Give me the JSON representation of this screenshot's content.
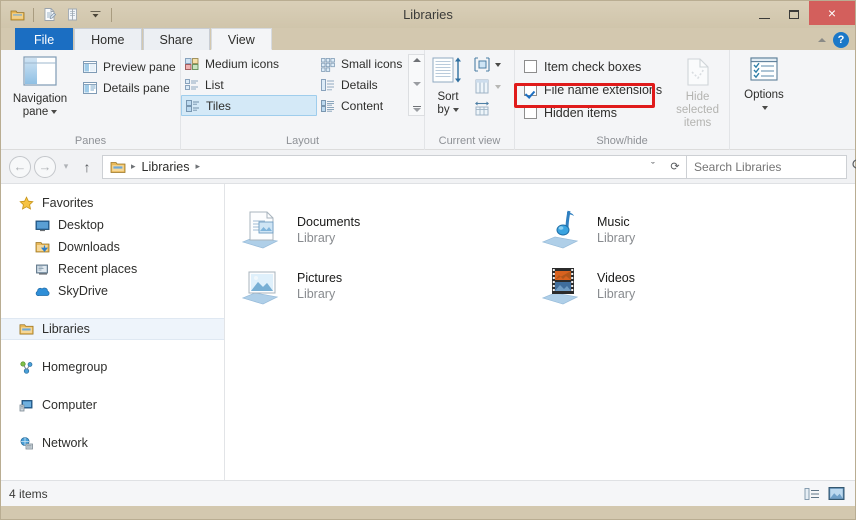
{
  "window": {
    "title": "Libraries",
    "quick_access": [
      "explorer-icon",
      "properties-icon",
      "new-folder-icon",
      "customize-caret"
    ],
    "minimize_label": "Minimize",
    "maximize_label": "Maximize",
    "close_label": "Close",
    "close_glyph": "×",
    "close_color": "#d35f5c",
    "titlebar_color": "#d3c8af"
  },
  "tabs": [
    {
      "label": "File",
      "active": false,
      "accent": "#1b6ec2"
    },
    {
      "label": "Home",
      "active": false
    },
    {
      "label": "Share",
      "active": false
    },
    {
      "label": "View",
      "active": true
    }
  ],
  "tab_right": {
    "collapse_label": "Minimize the Ribbon",
    "help_label": "Help",
    "help_glyph": "?"
  },
  "ribbon": {
    "groups": [
      {
        "label": "Panes",
        "big_button": {
          "label_line1": "Navigation",
          "label_line2": "pane",
          "has_caret": true
        },
        "small_items": [
          {
            "label": "Preview pane",
            "icon": "preview-pane-icon"
          },
          {
            "label": "Details pane",
            "icon": "details-pane-icon"
          }
        ]
      },
      {
        "label": "Layout",
        "items": [
          {
            "label": "Medium icons",
            "selected": false
          },
          {
            "label": "List",
            "selected": false
          },
          {
            "label": "Tiles",
            "selected": true
          },
          {
            "label": "Small icons",
            "selected": false
          },
          {
            "label": "Details",
            "selected": false
          },
          {
            "label": "Content",
            "selected": false
          }
        ],
        "scroll": {
          "up": "scroll-up",
          "down": "scroll-down",
          "more": "more-layouts"
        }
      },
      {
        "label": "Current view",
        "big_button": {
          "label_line1": "Sort",
          "label_line2": "by",
          "has_caret": true
        },
        "small_items": [
          {
            "label": "Group by",
            "icon": "group-by-icon",
            "caret": true,
            "disabled": false
          },
          {
            "label": "Add columns",
            "icon": "add-columns-icon",
            "caret": true,
            "disabled": true
          },
          {
            "label": "Size all columns to fit",
            "icon": "size-columns-icon",
            "caret": false,
            "disabled": false
          }
        ]
      },
      {
        "label": "Show/hide",
        "checkboxes": [
          {
            "label": "Item check boxes",
            "checked": false
          },
          {
            "label": "File name extensions",
            "checked": true,
            "annotated": true
          },
          {
            "label": "Hidden items",
            "checked": false
          }
        ],
        "big_button": {
          "label_line1": "Hide selected",
          "label_line2": "items",
          "disabled": true
        }
      },
      {
        "label": "",
        "big_button": {
          "label_line1": "Options",
          "label_line2": "",
          "has_caret": true
        }
      }
    ],
    "annotation_color": "#e01b1b",
    "check_color": "#1b6ec2",
    "selection_color": "#d4e9f7"
  },
  "address_bar": {
    "back_label": "Back",
    "back_glyph": "←",
    "forward_label": "Forward",
    "forward_glyph": "→",
    "recent_label": "Recent locations",
    "recent_glyph": "▾",
    "up_label": "Up to “Desktop”",
    "up_glyph": "↑",
    "breadcrumb_icon": "libraries-folder-icon",
    "breadcrumbs": [
      "Libraries"
    ],
    "separator_glyph": "▸",
    "history_glyph": "ˇ",
    "refresh_glyph": "⟳",
    "refresh_label": "Refresh",
    "search": {
      "placeholder": "Search Libraries",
      "value": "",
      "icon": "search-icon"
    }
  },
  "nav_pane": {
    "sections": [
      {
        "header": {
          "label": "Favorites",
          "icon": "star-icon"
        },
        "items": [
          {
            "label": "Desktop",
            "icon": "desktop-icon"
          },
          {
            "label": "Downloads",
            "icon": "downloads-icon"
          },
          {
            "label": "Recent places",
            "icon": "recent-places-icon"
          },
          {
            "label": "SkyDrive",
            "icon": "skydrive-icon"
          }
        ]
      },
      {
        "header": {
          "label": "Libraries",
          "icon": "libraries-icon",
          "selected": true
        },
        "items": []
      },
      {
        "header": {
          "label": "Homegroup",
          "icon": "homegroup-icon"
        },
        "items": []
      },
      {
        "header": {
          "label": "Computer",
          "icon": "computer-icon"
        },
        "items": []
      },
      {
        "header": {
          "label": "Network",
          "icon": "network-icon"
        },
        "items": []
      }
    ]
  },
  "content": {
    "view_mode": "Tiles",
    "tiles": [
      {
        "name": "Documents",
        "subtitle": "Library",
        "icon": "documents-library-icon"
      },
      {
        "name": "Music",
        "subtitle": "Library",
        "icon": "music-library-icon"
      },
      {
        "name": "Pictures",
        "subtitle": "Library",
        "icon": "pictures-library-icon"
      },
      {
        "name": "Videos",
        "subtitle": "Library",
        "icon": "videos-library-icon"
      }
    ]
  },
  "status_bar": {
    "item_count": "4 items",
    "details_view_label": "Details view",
    "large_icons_view_label": "Large icons view"
  }
}
